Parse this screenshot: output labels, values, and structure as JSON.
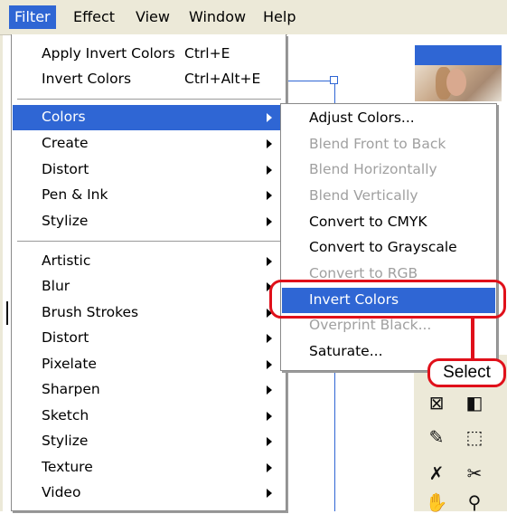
{
  "menubar": {
    "items": [
      "Filter",
      "Effect",
      "View",
      "Window",
      "Help"
    ],
    "active": "Filter"
  },
  "filter_menu": {
    "apply_invert": {
      "label": "Apply Invert Colors",
      "shortcut": "Ctrl+E"
    },
    "invert": {
      "label": "Invert Colors",
      "shortcut": "Ctrl+Alt+E"
    },
    "group1": [
      "Colors",
      "Create",
      "Distort",
      "Pen & Ink",
      "Stylize"
    ],
    "group2": [
      "Artistic",
      "Blur",
      "Brush Strokes",
      "Distort",
      "Pixelate",
      "Sharpen",
      "Sketch",
      "Stylize",
      "Texture",
      "Video"
    ]
  },
  "colors_submenu": {
    "items": [
      {
        "label": "Adjust Colors...",
        "enabled": true
      },
      {
        "label": "Blend Front to Back",
        "enabled": false
      },
      {
        "label": "Blend Horizontally",
        "enabled": false
      },
      {
        "label": "Blend Vertically",
        "enabled": false
      },
      {
        "label": "Convert to CMYK",
        "enabled": true
      },
      {
        "label": "Convert to Grayscale",
        "enabled": true
      },
      {
        "label": "Convert to RGB",
        "enabled": false
      },
      {
        "label": "Invert Colors",
        "enabled": true,
        "highlighted": true
      },
      {
        "label": "Overprint Black...",
        "enabled": false
      },
      {
        "label": "Saturate...",
        "enabled": true
      }
    ]
  },
  "annotation": {
    "callout": "Select"
  },
  "colors": {
    "highlight": "#2f66d4",
    "annotation": "#e0101a",
    "menubar": "#ece9d8"
  },
  "tool_icons": [
    "graph-icon",
    "gradient-icon",
    "eyedropper-icon",
    "blend-icon",
    "knife-icon",
    "scissors-icon",
    "hand-icon",
    "zoom-icon"
  ]
}
